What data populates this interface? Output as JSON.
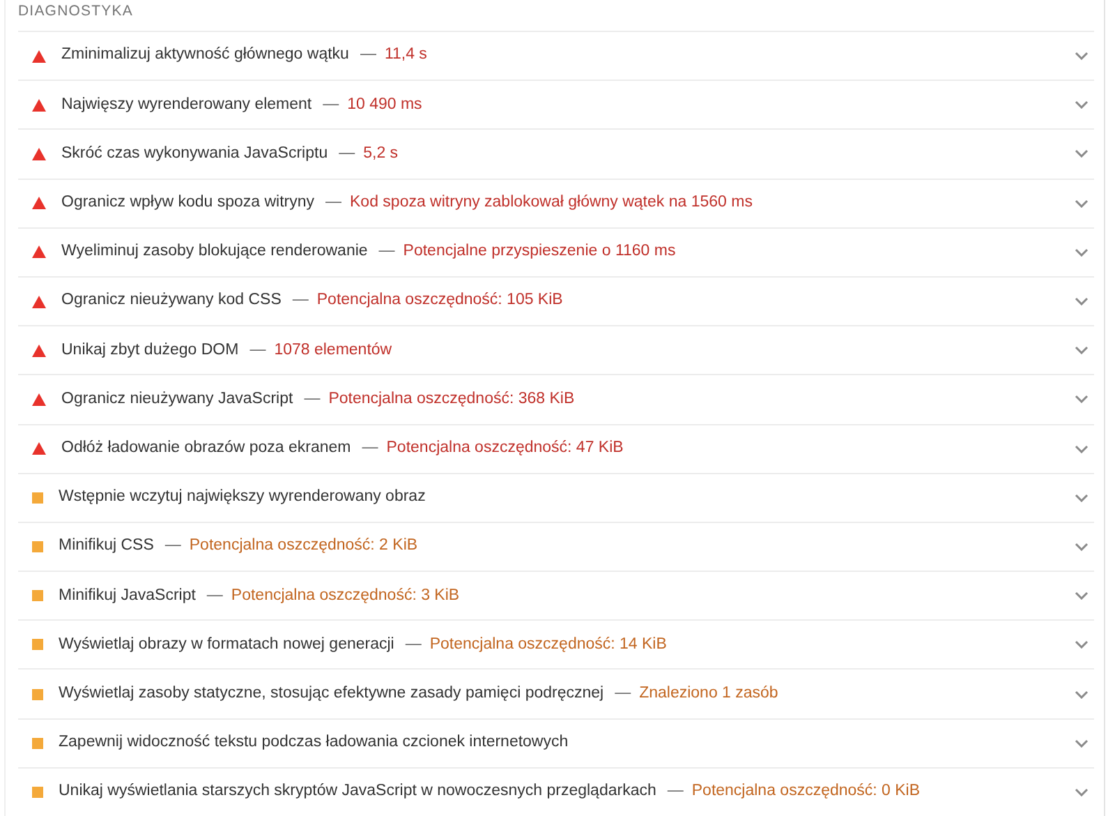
{
  "section_title": "DIAGNOSTYKA",
  "audits": [
    {
      "kind": "fail",
      "title": "Zminimalizuj aktywność głównego wątku",
      "separator": "—",
      "detail": "11,4 s",
      "expanded": false
    },
    {
      "kind": "fail",
      "title": "Najwięszy wyrenderowany element",
      "separator": "—",
      "detail": "10 490 ms",
      "expanded": false
    },
    {
      "kind": "fail",
      "title": "Skróć czas wykonywania JavaScriptu",
      "separator": "—",
      "detail": "5,2 s",
      "expanded": false
    },
    {
      "kind": "fail",
      "title": "Ogranicz wpływ kodu spoza witryny",
      "separator": "—",
      "detail": "Kod spoza witryny zablokował główny wątek na 1560 ms",
      "expanded": false
    },
    {
      "kind": "fail",
      "title": "Wyeliminuj zasoby blokujące renderowanie",
      "separator": "—",
      "detail": "Potencjalne przyspieszenie o 1160 ms",
      "expanded": false
    },
    {
      "kind": "fail",
      "title": "Ogranicz nieużywany kod CSS",
      "separator": "—",
      "detail": "Potencjalna oszczędność: 105 KiB",
      "expanded": false
    },
    {
      "kind": "fail",
      "title": "Unikaj zbyt dużego DOM",
      "separator": "—",
      "detail": "1078 elementów",
      "expanded": false
    },
    {
      "kind": "fail",
      "title": "Ogranicz nieużywany JavaScript",
      "separator": "—",
      "detail": "Potencjalna oszczędność: 368 KiB",
      "expanded": false
    },
    {
      "kind": "fail",
      "title": "Odłóż ładowanie obrazów poza ekranem",
      "separator": "—",
      "detail": "Potencjalna oszczędność: 47 KiB",
      "expanded": false
    },
    {
      "kind": "average",
      "title": "Wstępnie wczytuj największy wyrenderowany obraz",
      "expanded": false
    },
    {
      "kind": "average",
      "title": "Minifikuj CSS",
      "separator": "—",
      "detail": "Potencjalna oszczędność: 2 KiB",
      "expanded": false
    },
    {
      "kind": "average",
      "title": "Minifikuj JavaScript",
      "separator": "—",
      "detail": "Potencjalna oszczędność: 3 KiB",
      "expanded": false
    },
    {
      "kind": "average",
      "title": "Wyświetlaj obrazy w formatach nowej generacji",
      "separator": "—",
      "detail": "Potencjalna oszczędność: 14 KiB",
      "expanded": false
    },
    {
      "kind": "average",
      "title": "Wyświetlaj zasoby statyczne, stosując efektywne zasady pamięci podręcznej",
      "separator": "—",
      "detail": "Znaleziono 1 zasób",
      "expanded": false
    },
    {
      "kind": "average",
      "title": "Zapewnij widoczność tekstu podczas ładowania czcionek internetowych",
      "expanded": false
    },
    {
      "kind": "average",
      "title": "Unikaj wyświetlania starszych skryptów JavaScript w nowoczesnych przeglądarkach",
      "separator": "—",
      "detail": "Potencjalna oszczędność: 0 KiB",
      "expanded": false
    }
  ]
}
